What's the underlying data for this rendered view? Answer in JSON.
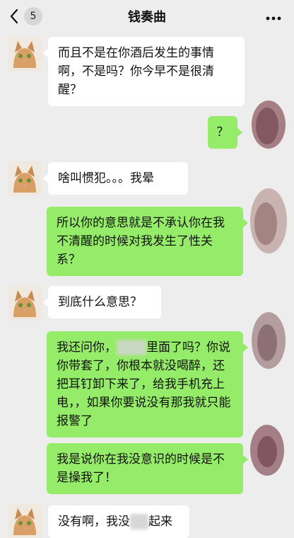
{
  "header": {
    "title": "钱奏曲",
    "back_count": "5",
    "back_icon": "chevron-left-icon",
    "more_icon": "more-horizontal-icon"
  },
  "messages": [
    {
      "from": "other",
      "text": "而且不是在你酒后发生的事情啊，不是吗？你今早不是很清醒？"
    },
    {
      "from": "me",
      "text": "？"
    },
    {
      "from": "other",
      "text": "啥叫惯犯。。。我晕"
    },
    {
      "from": "me",
      "text": "所以你的意思就是不承认你在我不清醒的时候对我发生了性关系？"
    },
    {
      "from": "other",
      "text": "到底什么意思？"
    },
    {
      "from": "me",
      "text_a": "我还问你，",
      "text_b": "里面了吗？你说你带套了，你根本就没喝醉，还把耳钉卸下来了，给我手机充上电，，如果你要说没有那我就只能报警了"
    },
    {
      "from": "me",
      "text": "我是说你在我没意识的时候是不是操我了！"
    },
    {
      "from": "other",
      "text_a": "没有啊，我没",
      "text_b": "起来"
    }
  ],
  "colors": {
    "outgoing": "#95ec69",
    "incoming": "#ffffff",
    "background": "#ededed"
  }
}
